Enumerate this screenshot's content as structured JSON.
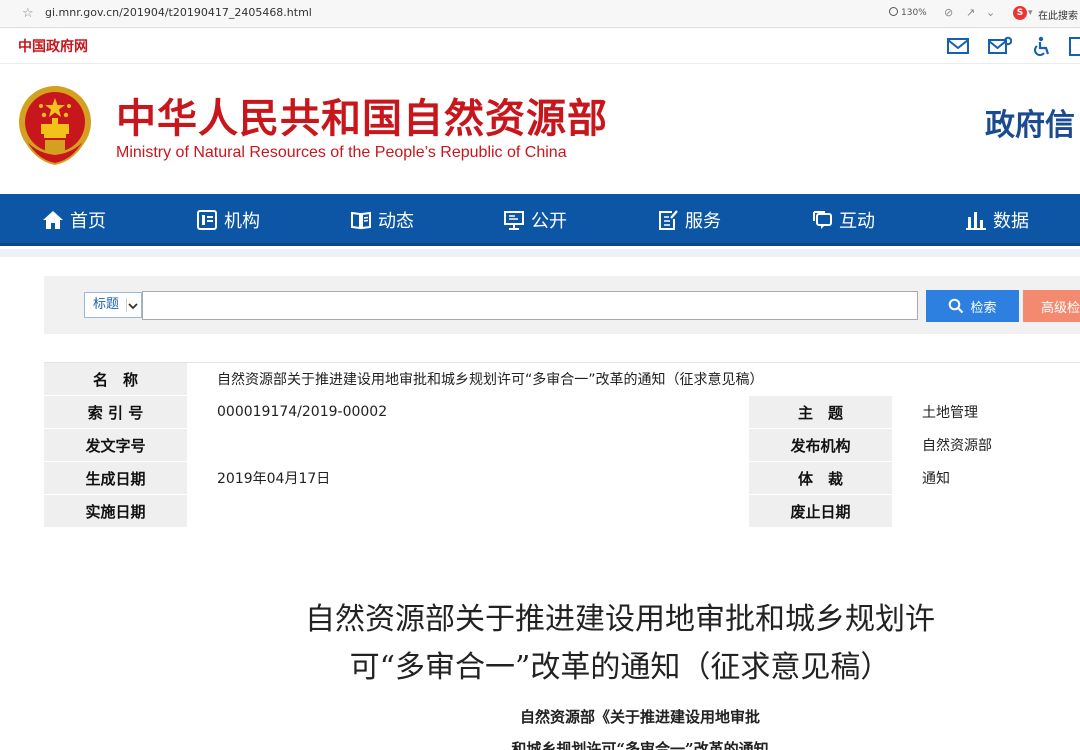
{
  "browser": {
    "url": "gi.mnr.gov.cn/201904/t20190417_2405468.html",
    "zoom": "130%",
    "search_hint": "在此搜索"
  },
  "top": {
    "gov_link": "中国政府网"
  },
  "header": {
    "title": "中华人民共和国自然资源部",
    "subtitle": "Ministry of Natural Resources of the People’s Republic of China",
    "right_title": "政府信"
  },
  "nav": {
    "items": [
      "首页",
      "机构",
      "动态",
      "公开",
      "服务",
      "互动",
      "数据"
    ]
  },
  "search": {
    "field_option": "标题",
    "button": "检索",
    "advanced": "高级检"
  },
  "info": {
    "name_label": "名　称",
    "name_value": "自然资源部关于推进建设用地审批和城乡规划许可“多审合一”改革的通知（征求意见稿）",
    "index_label": "索 引 号",
    "index_value": "000019174/2019-00002",
    "subject_label": "主　题",
    "subject_value": "土地管理",
    "docno_label": "发文字号",
    "docno_value": "",
    "org_label": "发布机构",
    "org_value": "自然资源部",
    "date_label": "生成日期",
    "date_value": "2019年04月17日",
    "genre_label": "体　裁",
    "genre_value": "通知",
    "effective_label": "实施日期",
    "effective_value": "",
    "expire_label": "废止日期",
    "expire_value": ""
  },
  "article": {
    "title_line1": "自然资源部关于推进建设用地审批和城乡规划许",
    "title_line2": "可“多审合一”改革的通知（征求意见稿）",
    "meta_line1": "自然资源部《关于推进建设用地审批",
    "meta_line2": "和城乡规划许可“多审合一”改革的通知"
  },
  "colors": {
    "brand_red": "#c8161d",
    "nav_blue": "#0d56a6",
    "search_blue": "#2d7fe0",
    "advanced_orange": "#f38a70"
  }
}
